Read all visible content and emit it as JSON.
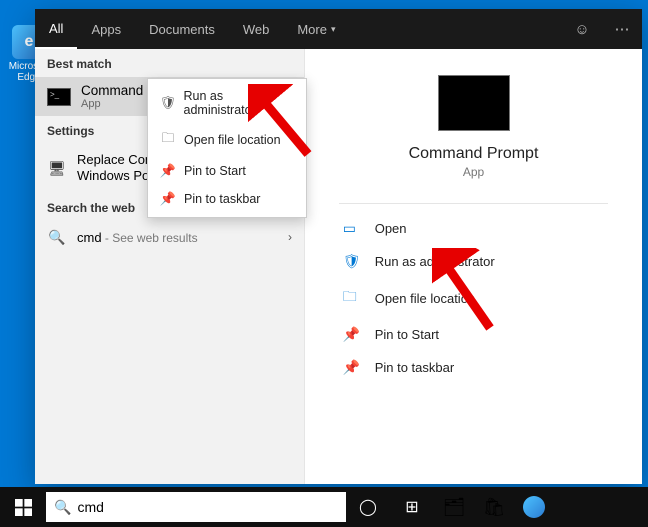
{
  "desktop": {
    "edge_label": "Microsoft Edge"
  },
  "tabs": {
    "all": "All",
    "apps": "Apps",
    "documents": "Documents",
    "web": "Web",
    "more": "More"
  },
  "sections": {
    "best_match": "Best match",
    "settings": "Settings",
    "search_web": "Search the web"
  },
  "best_match": {
    "title": "Command Prompt",
    "subtitle": "App"
  },
  "settings_item": "Replace Command Prompt with Windows PowerShell",
  "web_item": {
    "query": "cmd",
    "suffix": " - See web results"
  },
  "context_menu": {
    "run_admin": "Run as administrator",
    "open_loc": "Open file location",
    "pin_start": "Pin to Start",
    "pin_taskbar": "Pin to taskbar"
  },
  "detail": {
    "title": "Command Prompt",
    "subtitle": "App",
    "actions": {
      "open": "Open",
      "run_admin": "Run as administrator",
      "open_loc": "Open file location",
      "pin_start": "Pin to Start",
      "pin_taskbar": "Pin to taskbar"
    }
  },
  "search_value": "cmd",
  "colors": {
    "accent": "#0078d4"
  }
}
